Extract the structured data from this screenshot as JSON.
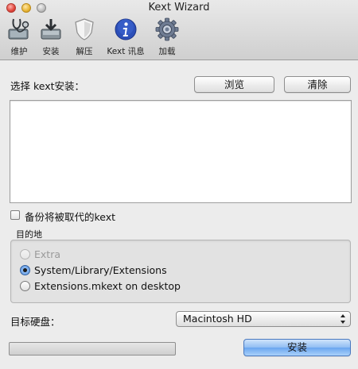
{
  "window": {
    "title": "Kext Wizard"
  },
  "toolbar": {
    "items": [
      {
        "label": "维护",
        "icon": "stethoscope-icon"
      },
      {
        "label": "安装",
        "icon": "install-disk-icon"
      },
      {
        "label": "解压",
        "icon": "shield-icon"
      },
      {
        "label": "Kext 讯息",
        "icon": "info-icon"
      },
      {
        "label": "加载",
        "icon": "gear-icon"
      }
    ]
  },
  "install": {
    "select_label": "选择 kext安装：",
    "browse_label": "浏览",
    "clear_label": "清除",
    "kext_list": [],
    "backup_label": "备份将被取代的kext",
    "backup_checked": false,
    "destination_label": "目的地",
    "destinations": [
      {
        "label": "Extra",
        "selected": false,
        "enabled": false
      },
      {
        "label": "System/Library/Extensions",
        "selected": true,
        "enabled": true
      },
      {
        "label": "Extensions.mkext on desktop",
        "selected": false,
        "enabled": true
      }
    ],
    "target_disk_label": "目标硬盘：",
    "target_disk_value": "Macintosh HD",
    "progress": 0,
    "install_label": "安装"
  },
  "colors": {
    "accent": "#6aa5ef",
    "window_bg": "#ececec"
  }
}
